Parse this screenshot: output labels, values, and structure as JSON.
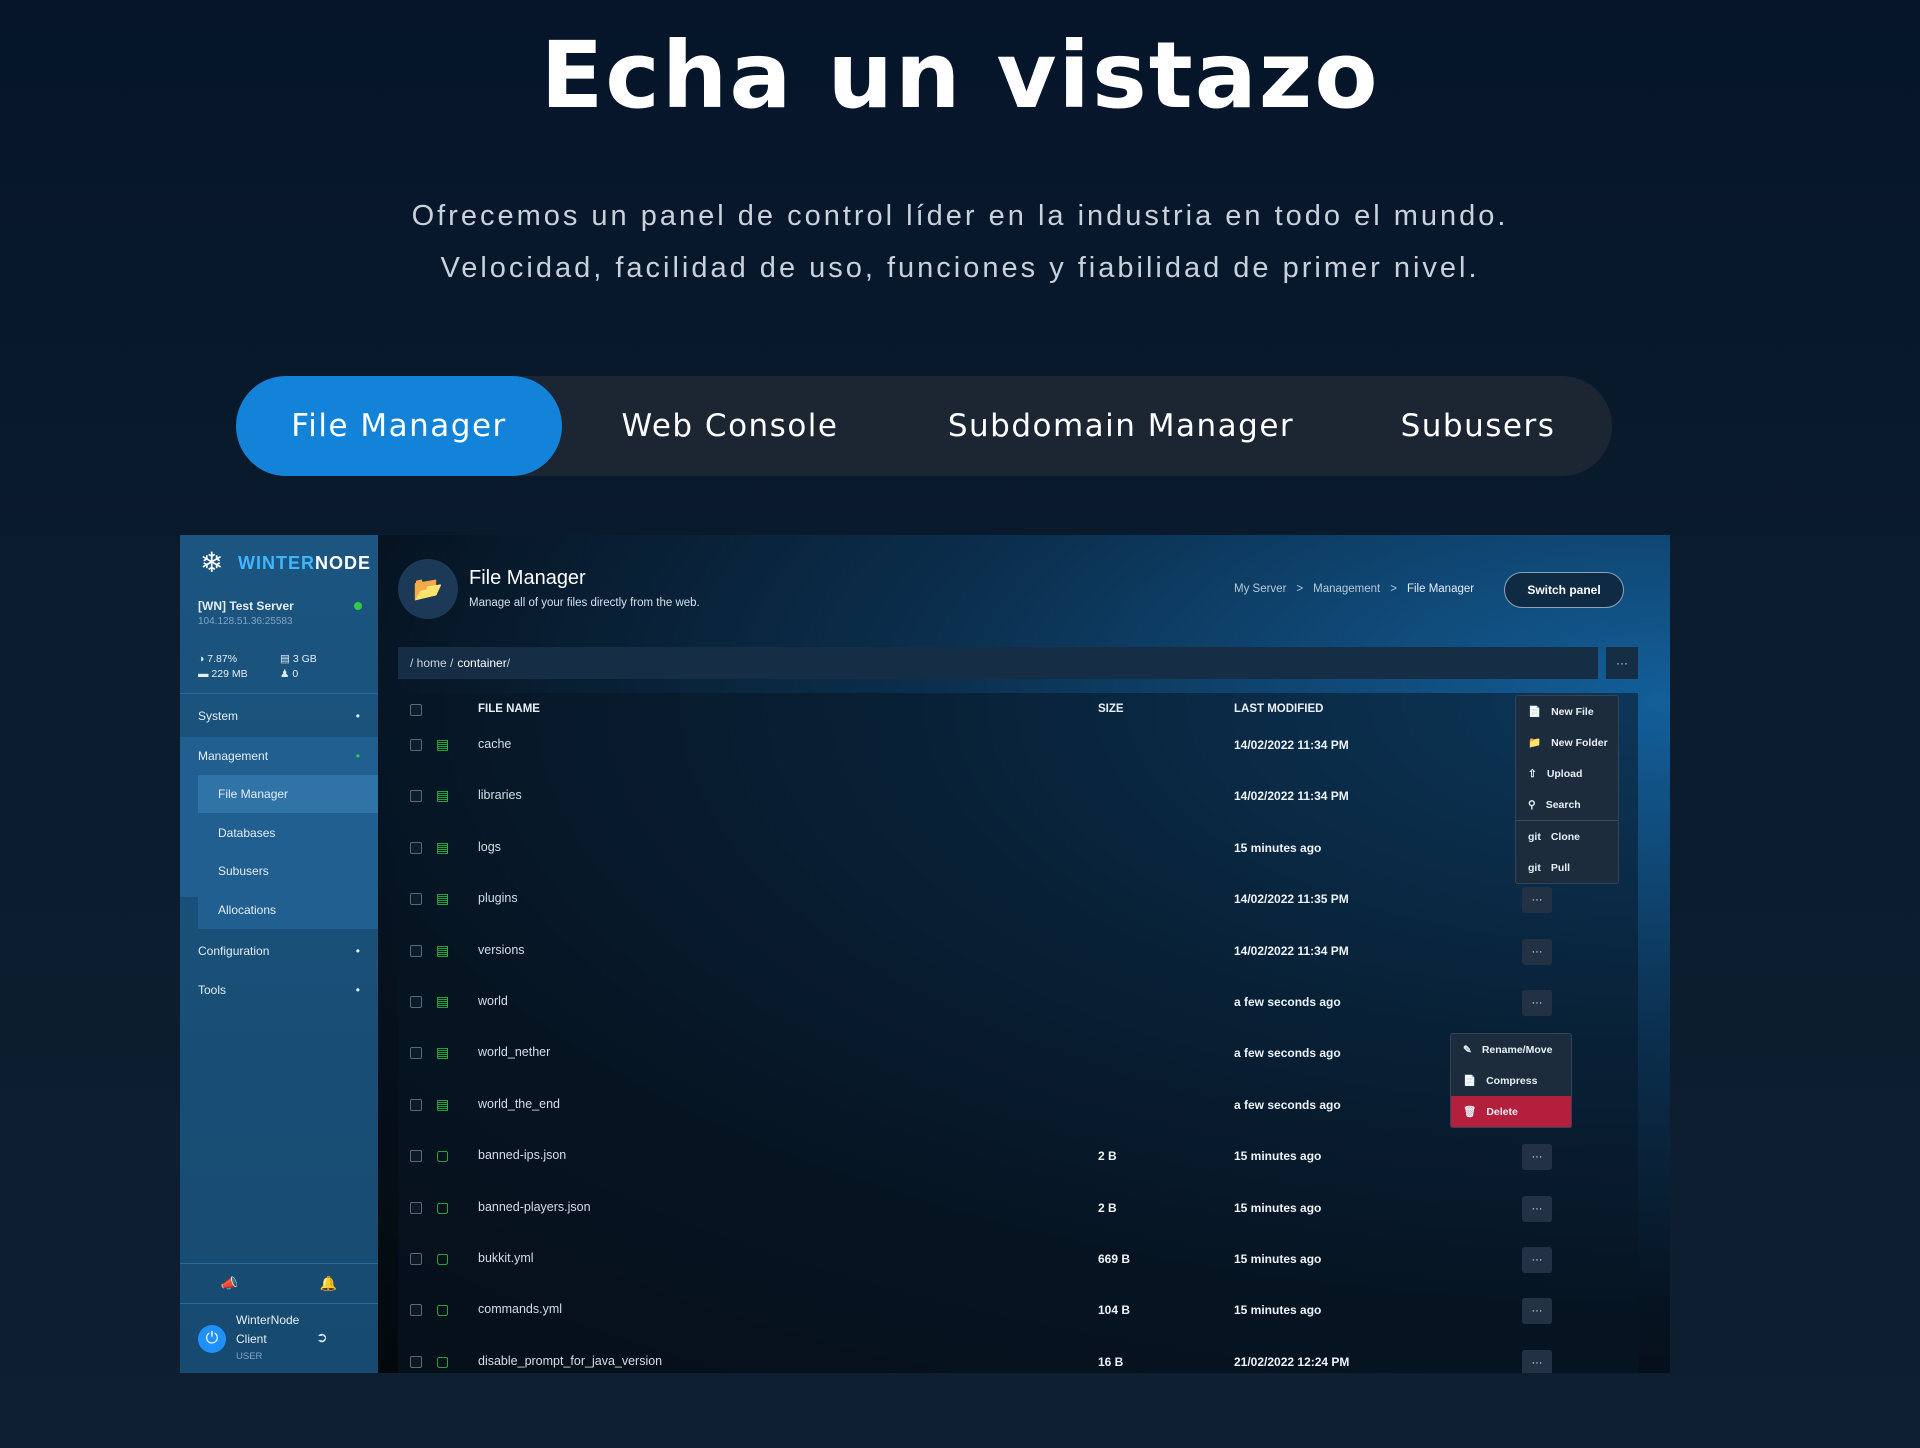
{
  "hero": {
    "title": "Echa un vistazo",
    "subtitle_line1": "Ofrecemos un panel de control líder en la industria en todo el mundo.",
    "subtitle_line2": "Velocidad, facilidad de uso, funciones y fiabilidad de primer nivel."
  },
  "tabs": [
    {
      "label": "File Manager",
      "active": true
    },
    {
      "label": "Web Console",
      "active": false
    },
    {
      "label": "Subdomain Manager",
      "active": false
    },
    {
      "label": "Subusers",
      "active": false
    }
  ],
  "panel": {
    "brand": {
      "part1": "WINTER",
      "part2": "NODE"
    },
    "server": {
      "name": "[WN] Test Server",
      "ip": "104.128.51.36:25583",
      "status_color": "#2ecc40"
    },
    "stats": {
      "cpu": "7.87%",
      "disk": "3 GB",
      "memory": "229 MB",
      "players": "0"
    },
    "nav": {
      "system": "System",
      "management": "Management",
      "file_manager": "File Manager",
      "databases": "Databases",
      "subusers": "Subusers",
      "allocations": "Allocations",
      "configuration": "Configuration",
      "tools": "Tools"
    },
    "user": {
      "name_line1": "WinterNode",
      "name_line2": "Client",
      "role": "USER"
    },
    "header": {
      "title": "File Manager",
      "description": "Manage all of your files directly from the web.",
      "breadcrumb": [
        "My Server",
        ">",
        "Management",
        ">",
        "File Manager"
      ],
      "switch_panel": "Switch panel"
    },
    "path": {
      "prefix": "/ home / ",
      "current": "container",
      "suffix": " /",
      "more": "···"
    },
    "columns": {
      "name": "FILE NAME",
      "size": "SIZE",
      "modified": "LAST MODIFIED"
    },
    "rows": [
      {
        "type": "folder",
        "name": "cache",
        "size": "",
        "modified": "14/02/2022 11:34 PM"
      },
      {
        "type": "folder",
        "name": "libraries",
        "size": "",
        "modified": "14/02/2022 11:34 PM"
      },
      {
        "type": "folder",
        "name": "logs",
        "size": "",
        "modified": "15 minutes ago"
      },
      {
        "type": "folder",
        "name": "plugins",
        "size": "",
        "modified": "14/02/2022 11:35 PM"
      },
      {
        "type": "folder",
        "name": "versions",
        "size": "",
        "modified": "14/02/2022 11:34 PM"
      },
      {
        "type": "folder",
        "name": "world",
        "size": "",
        "modified": "a few seconds ago"
      },
      {
        "type": "folder",
        "name": "world_nether",
        "size": "",
        "modified": "a few seconds ago"
      },
      {
        "type": "folder",
        "name": "world_the_end",
        "size": "",
        "modified": "a few seconds ago"
      },
      {
        "type": "file",
        "name": "banned-ips.json",
        "size": "2 B",
        "modified": "15 minutes ago"
      },
      {
        "type": "file",
        "name": "banned-players.json",
        "size": "2 B",
        "modified": "15 minutes ago"
      },
      {
        "type": "file",
        "name": "bukkit.yml",
        "size": "669 B",
        "modified": "15 minutes ago"
      },
      {
        "type": "file",
        "name": "commands.yml",
        "size": "104 B",
        "modified": "15 minutes ago"
      },
      {
        "type": "file",
        "name": "disable_prompt_for_java_version",
        "size": "16 B",
        "modified": "21/02/2022 12:24 PM"
      }
    ],
    "row_more": "···",
    "create_menu": [
      "New File",
      "New Folder",
      "Upload",
      "Search",
      "Clone",
      "Pull"
    ],
    "git_tag": "git",
    "row_menu": [
      "Rename/Move",
      "Compress",
      "Delete"
    ]
  },
  "colors": {
    "accent": "#1283d8",
    "folder": "#2ecc40",
    "danger": "#b51f3e",
    "discord": "#5865f2"
  }
}
